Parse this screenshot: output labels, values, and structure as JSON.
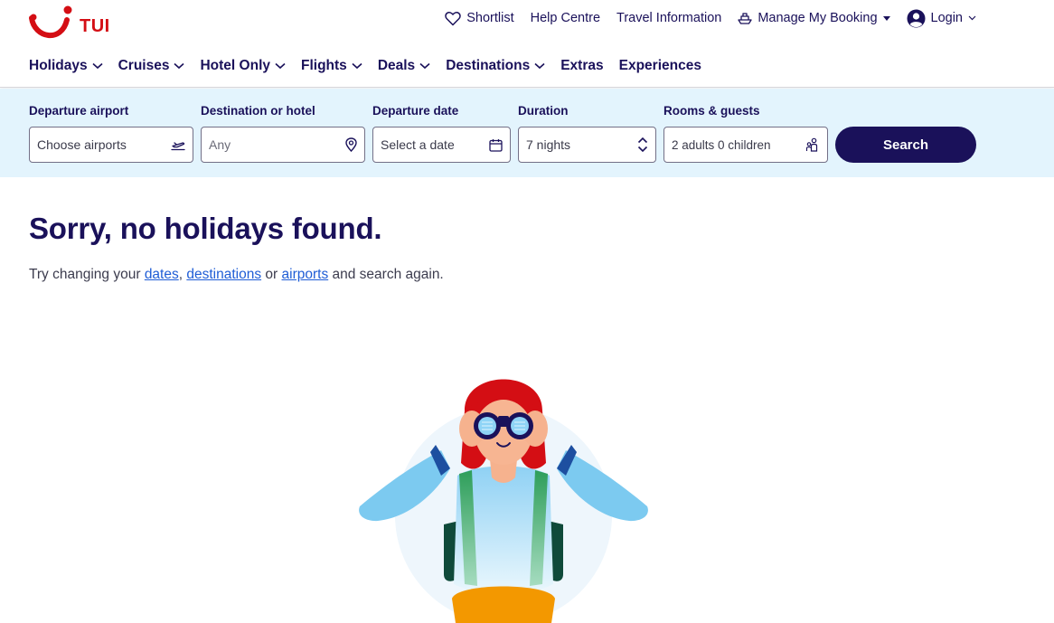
{
  "brand": {
    "logo_text": "TUI",
    "accent": "#d40e14",
    "navy": "#1a115a",
    "link": "#1f5dd6",
    "search_bg": "#e3f4fd"
  },
  "utility_nav": {
    "shortlist": "Shortlist",
    "help": "Help Centre",
    "travel_info": "Travel Information",
    "manage_booking": "Manage My Booking",
    "login": "Login"
  },
  "main_nav": [
    {
      "label": "Holidays",
      "has_dropdown": true
    },
    {
      "label": "Cruises",
      "has_dropdown": true
    },
    {
      "label": "Hotel Only",
      "has_dropdown": true
    },
    {
      "label": "Flights",
      "has_dropdown": true
    },
    {
      "label": "Deals",
      "has_dropdown": true
    },
    {
      "label": "Destinations",
      "has_dropdown": true
    },
    {
      "label": "Extras",
      "has_dropdown": false
    },
    {
      "label": "Experiences",
      "has_dropdown": false
    }
  ],
  "search": {
    "departure": {
      "label": "Departure airport",
      "placeholder": "Choose airports",
      "icon": "plane-takeoff-icon"
    },
    "destination": {
      "label": "Destination or hotel",
      "placeholder": "Any",
      "icon": "location-pin-icon"
    },
    "date": {
      "label": "Departure date",
      "placeholder": "Select a date",
      "icon": "calendar-icon"
    },
    "duration": {
      "label": "Duration",
      "value": "7 nights",
      "icon": "up-down-chevron-icon"
    },
    "guests": {
      "label": "Rooms & guests",
      "value": "2 adults 0 children",
      "icon": "people-icon"
    },
    "button": "Search"
  },
  "results": {
    "title": "Sorry, no holidays found.",
    "message_prefix": "Try changing your",
    "link_dates": "dates",
    "comma": ",",
    "link_destinations": "destinations",
    "or": "or",
    "link_airports": "airports",
    "message_suffix": "and search again."
  }
}
